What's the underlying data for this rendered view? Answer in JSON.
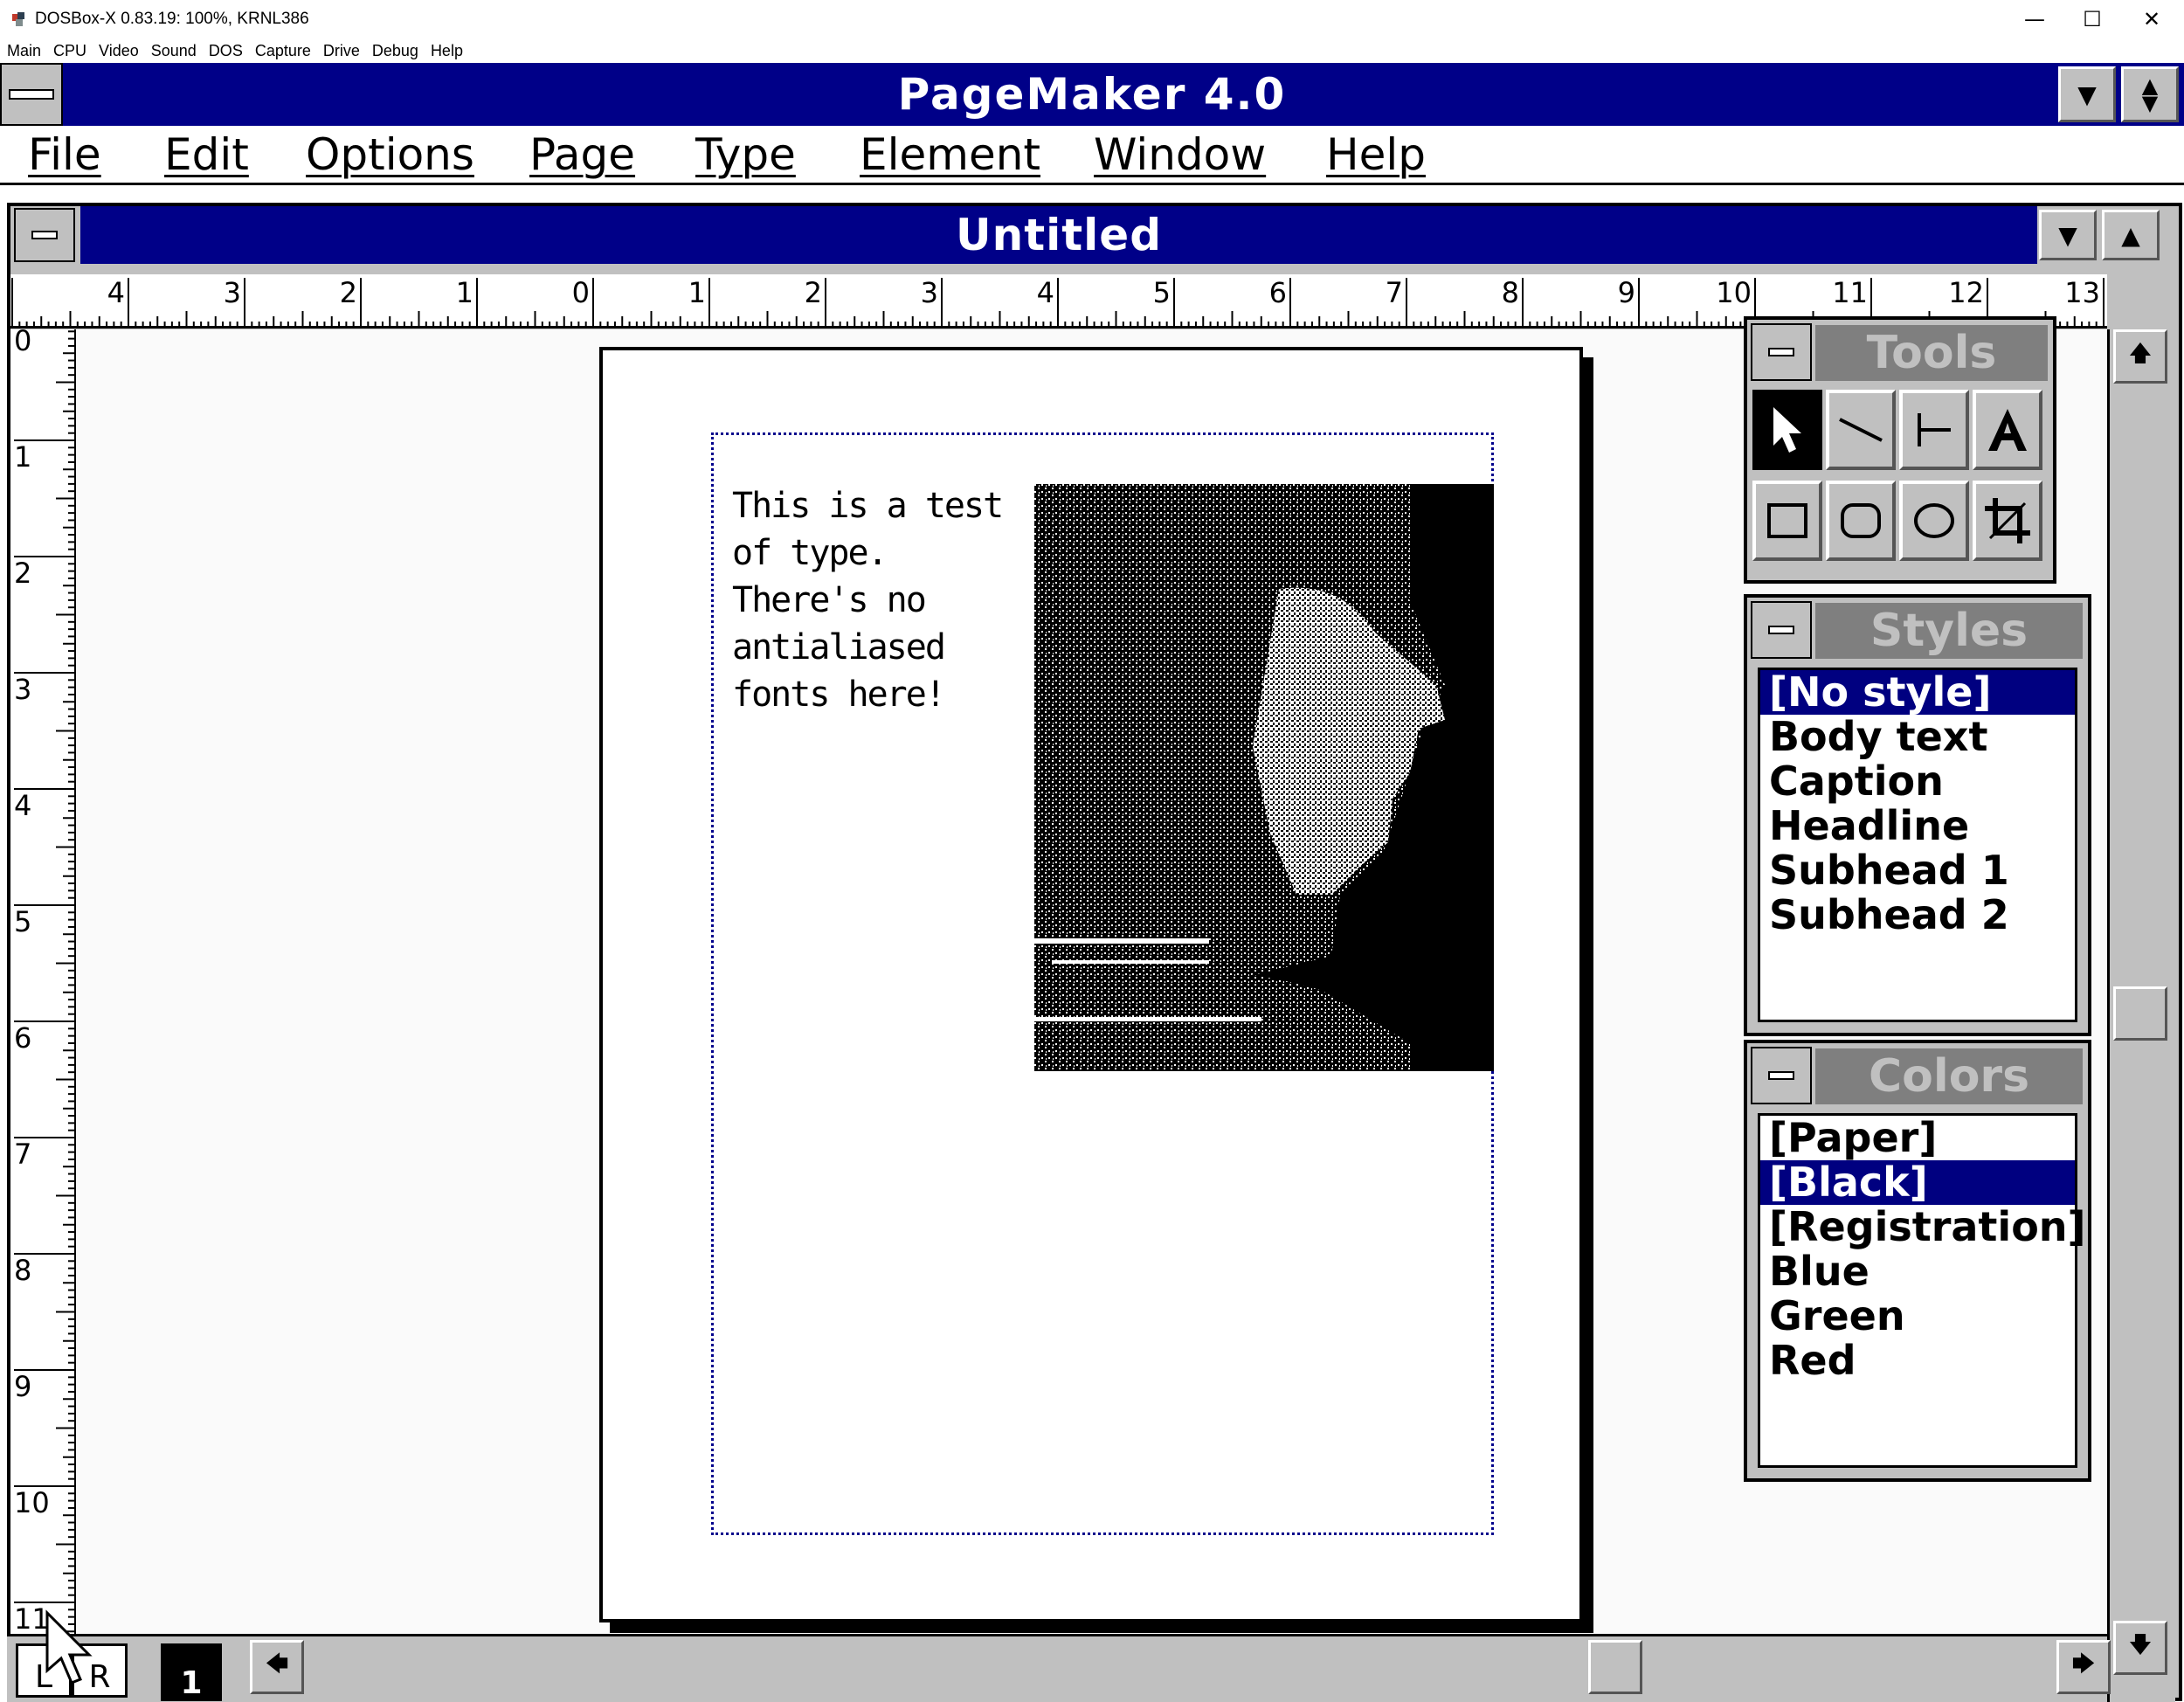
{
  "host": {
    "title": "DOSBox-X 0.83.19: 100%, KRNL386",
    "menu": [
      "Main",
      "CPU",
      "Video",
      "Sound",
      "DOS",
      "Capture",
      "Drive",
      "Debug",
      "Help"
    ],
    "minimize_glyph": "—",
    "maximize_glyph": "☐",
    "close_glyph": "✕"
  },
  "app": {
    "title": "PageMaker 4.0",
    "menu": [
      "File",
      "Edit",
      "Options",
      "Page",
      "Type",
      "Element",
      "Window",
      "Help"
    ]
  },
  "document": {
    "title": "Untitled",
    "body_text": "This is a test of type. There's no antialiased fonts here!"
  },
  "rulers": {
    "horizontal": [
      "4",
      "3",
      "2",
      "1",
      "0",
      "1",
      "2",
      "3",
      "4",
      "5",
      "6",
      "7",
      "8",
      "9",
      "10",
      "11",
      "12",
      "13"
    ],
    "vertical": [
      "0",
      "1",
      "2",
      "3",
      "4",
      "5",
      "6",
      "7",
      "8",
      "9",
      "10",
      "11"
    ]
  },
  "pages": {
    "left_label": "L",
    "right_label": "R",
    "current": "1"
  },
  "tools": {
    "title": "Tools",
    "items": [
      "pointer-icon",
      "line-icon",
      "perpendicular-line-icon",
      "text-tool-icon",
      "rectangle-icon",
      "rounded-rectangle-icon",
      "ellipse-icon",
      "crop-icon"
    ]
  },
  "styles": {
    "title": "Styles",
    "items": [
      "[No style]",
      "Body text",
      "Caption",
      "Headline",
      "Subhead 1",
      "Subhead 2"
    ],
    "selected": 0
  },
  "colors": {
    "title": "Colors",
    "items": [
      "[Paper]",
      "[Black]",
      "[Registration]",
      "Blue",
      "Green",
      "Red"
    ],
    "selected": 1
  },
  "theme": {
    "title_bar": "#000088",
    "selection": "#000080",
    "chrome": "#c0c0c0",
    "margin_guide": "#00008c"
  }
}
